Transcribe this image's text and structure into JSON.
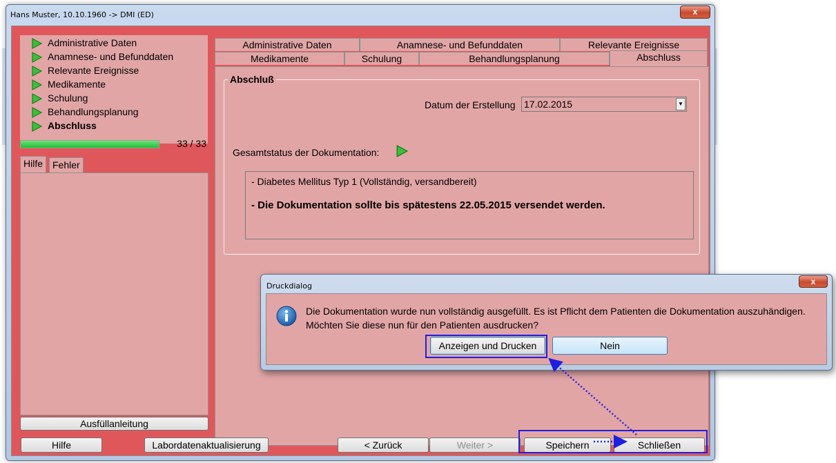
{
  "window": {
    "title": "Hans Muster, 10.10.1960 -> DMI (ED)",
    "close_label": "x"
  },
  "nav": {
    "items": [
      {
        "label": "Administrative Daten"
      },
      {
        "label": "Anamnese- und Befunddaten"
      },
      {
        "label": "Relevante Ereignisse"
      },
      {
        "label": "Medikamente"
      },
      {
        "label": "Schulung"
      },
      {
        "label": "Behandlungsplanung"
      },
      {
        "label": "Abschluss"
      }
    ],
    "icon": "play-arrow-green-icon"
  },
  "progress": {
    "text": "33 / 33",
    "fraction": 1.0,
    "color": "#1fbf33"
  },
  "help_tabs": {
    "hilfe": "Hilfe",
    "fehler": "Fehler"
  },
  "buttons": {
    "ausfuellanleitung": "Ausfüllanleitung",
    "hilfe": "Hilfe",
    "labor": "Labordatenaktualisierung",
    "zurueck": "< Zurück",
    "weiter": "Weiter >",
    "speichern": "Speichern",
    "schliessen": "Schließen"
  },
  "tabs": {
    "row1": [
      "Administrative Daten",
      "Anamnese- und Befunddaten",
      "Relevante Ereignisse"
    ],
    "row2": [
      "Medikamente",
      "Schulung",
      "Behandlungsplanung",
      "Abschluss"
    ],
    "active": "Abschluss"
  },
  "abschluss": {
    "group_title": "Abschluß",
    "date_label": "Datum der Erstellung",
    "date_value": "17.02.2015",
    "status_label": "Gesamtstatus der Dokumentation:",
    "status_line1": "- Diabetes Mellitus Typ 1  (Vollständig, versandbereit)",
    "status_line2": "- Die Dokumentation sollte bis spätestens 22.05.2015 versendet werden."
  },
  "dialog": {
    "title": "Druckdialog",
    "close_label": "x",
    "message_line1": "Die Dokumentation wurde nun vollständig ausgefüllt. Es ist Pflicht dem Patienten die Dokumentation auszuhändigen.",
    "message_line2": "Möchten Sie diese nun für den Patienten ausdrucken?",
    "btn_show": "Anzeigen und Drucken",
    "btn_no": "Nein"
  },
  "colors": {
    "client_bg": "#e0575b",
    "panel_bg": "#e2a5a6",
    "highlight": "#1f1fe0",
    "icon_green": "#3bbf3b"
  }
}
